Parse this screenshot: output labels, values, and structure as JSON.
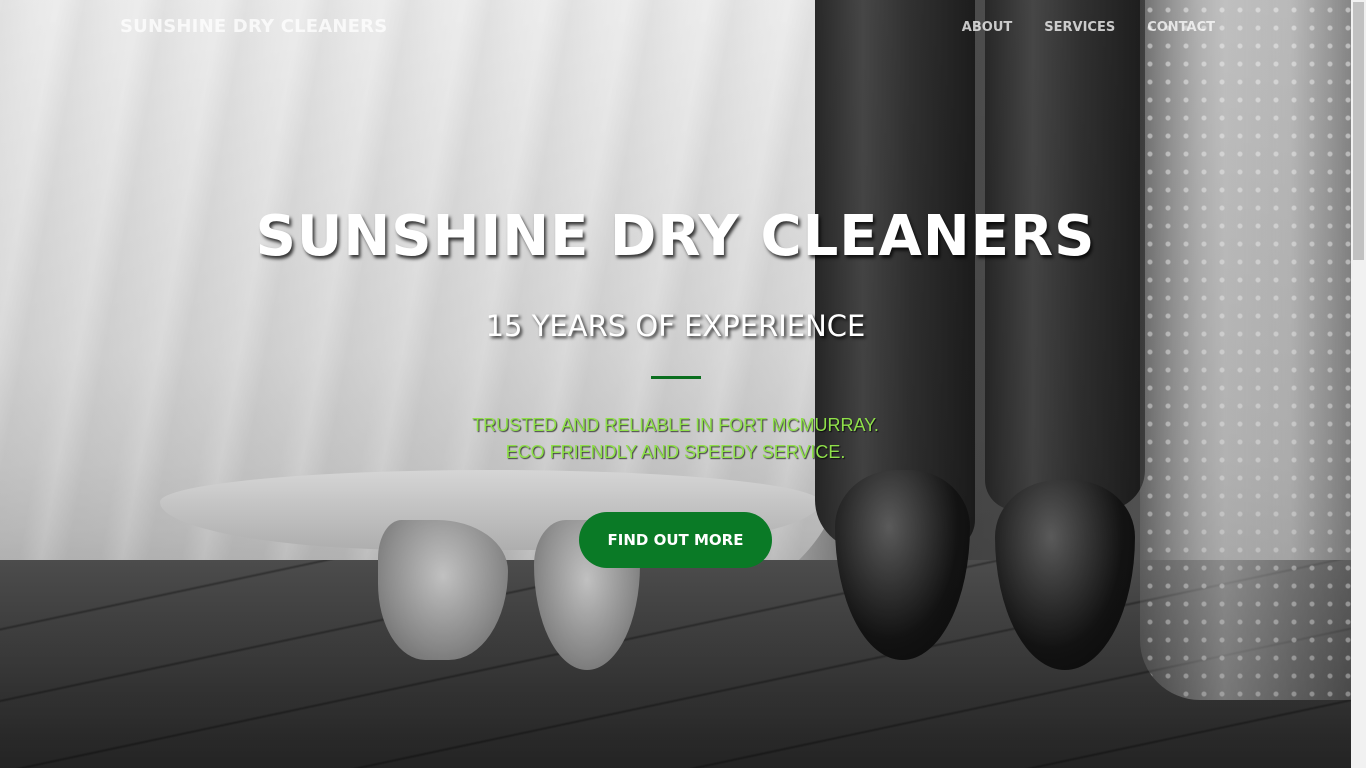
{
  "navbar": {
    "brand": "SUNSHINE DRY CLEANERS",
    "links": [
      {
        "label": "ABOUT"
      },
      {
        "label": "SERVICES"
      },
      {
        "label": "CONTACT"
      }
    ]
  },
  "hero": {
    "title": "SUNSHINE DRY CLEANERS",
    "subtitle": "15 YEARS OF EXPERIENCE",
    "tagline_lines": [
      "TRUSTED AND RELIABLE IN FORT MCMURRAY.",
      "ECO FRIENDLY AND SPEEDY SERVICE."
    ],
    "cta_label": "FIND OUT MORE"
  },
  "colors": {
    "accent": "#0a7a26",
    "tagline": "#8fe04a",
    "heading": "#ffffff"
  }
}
